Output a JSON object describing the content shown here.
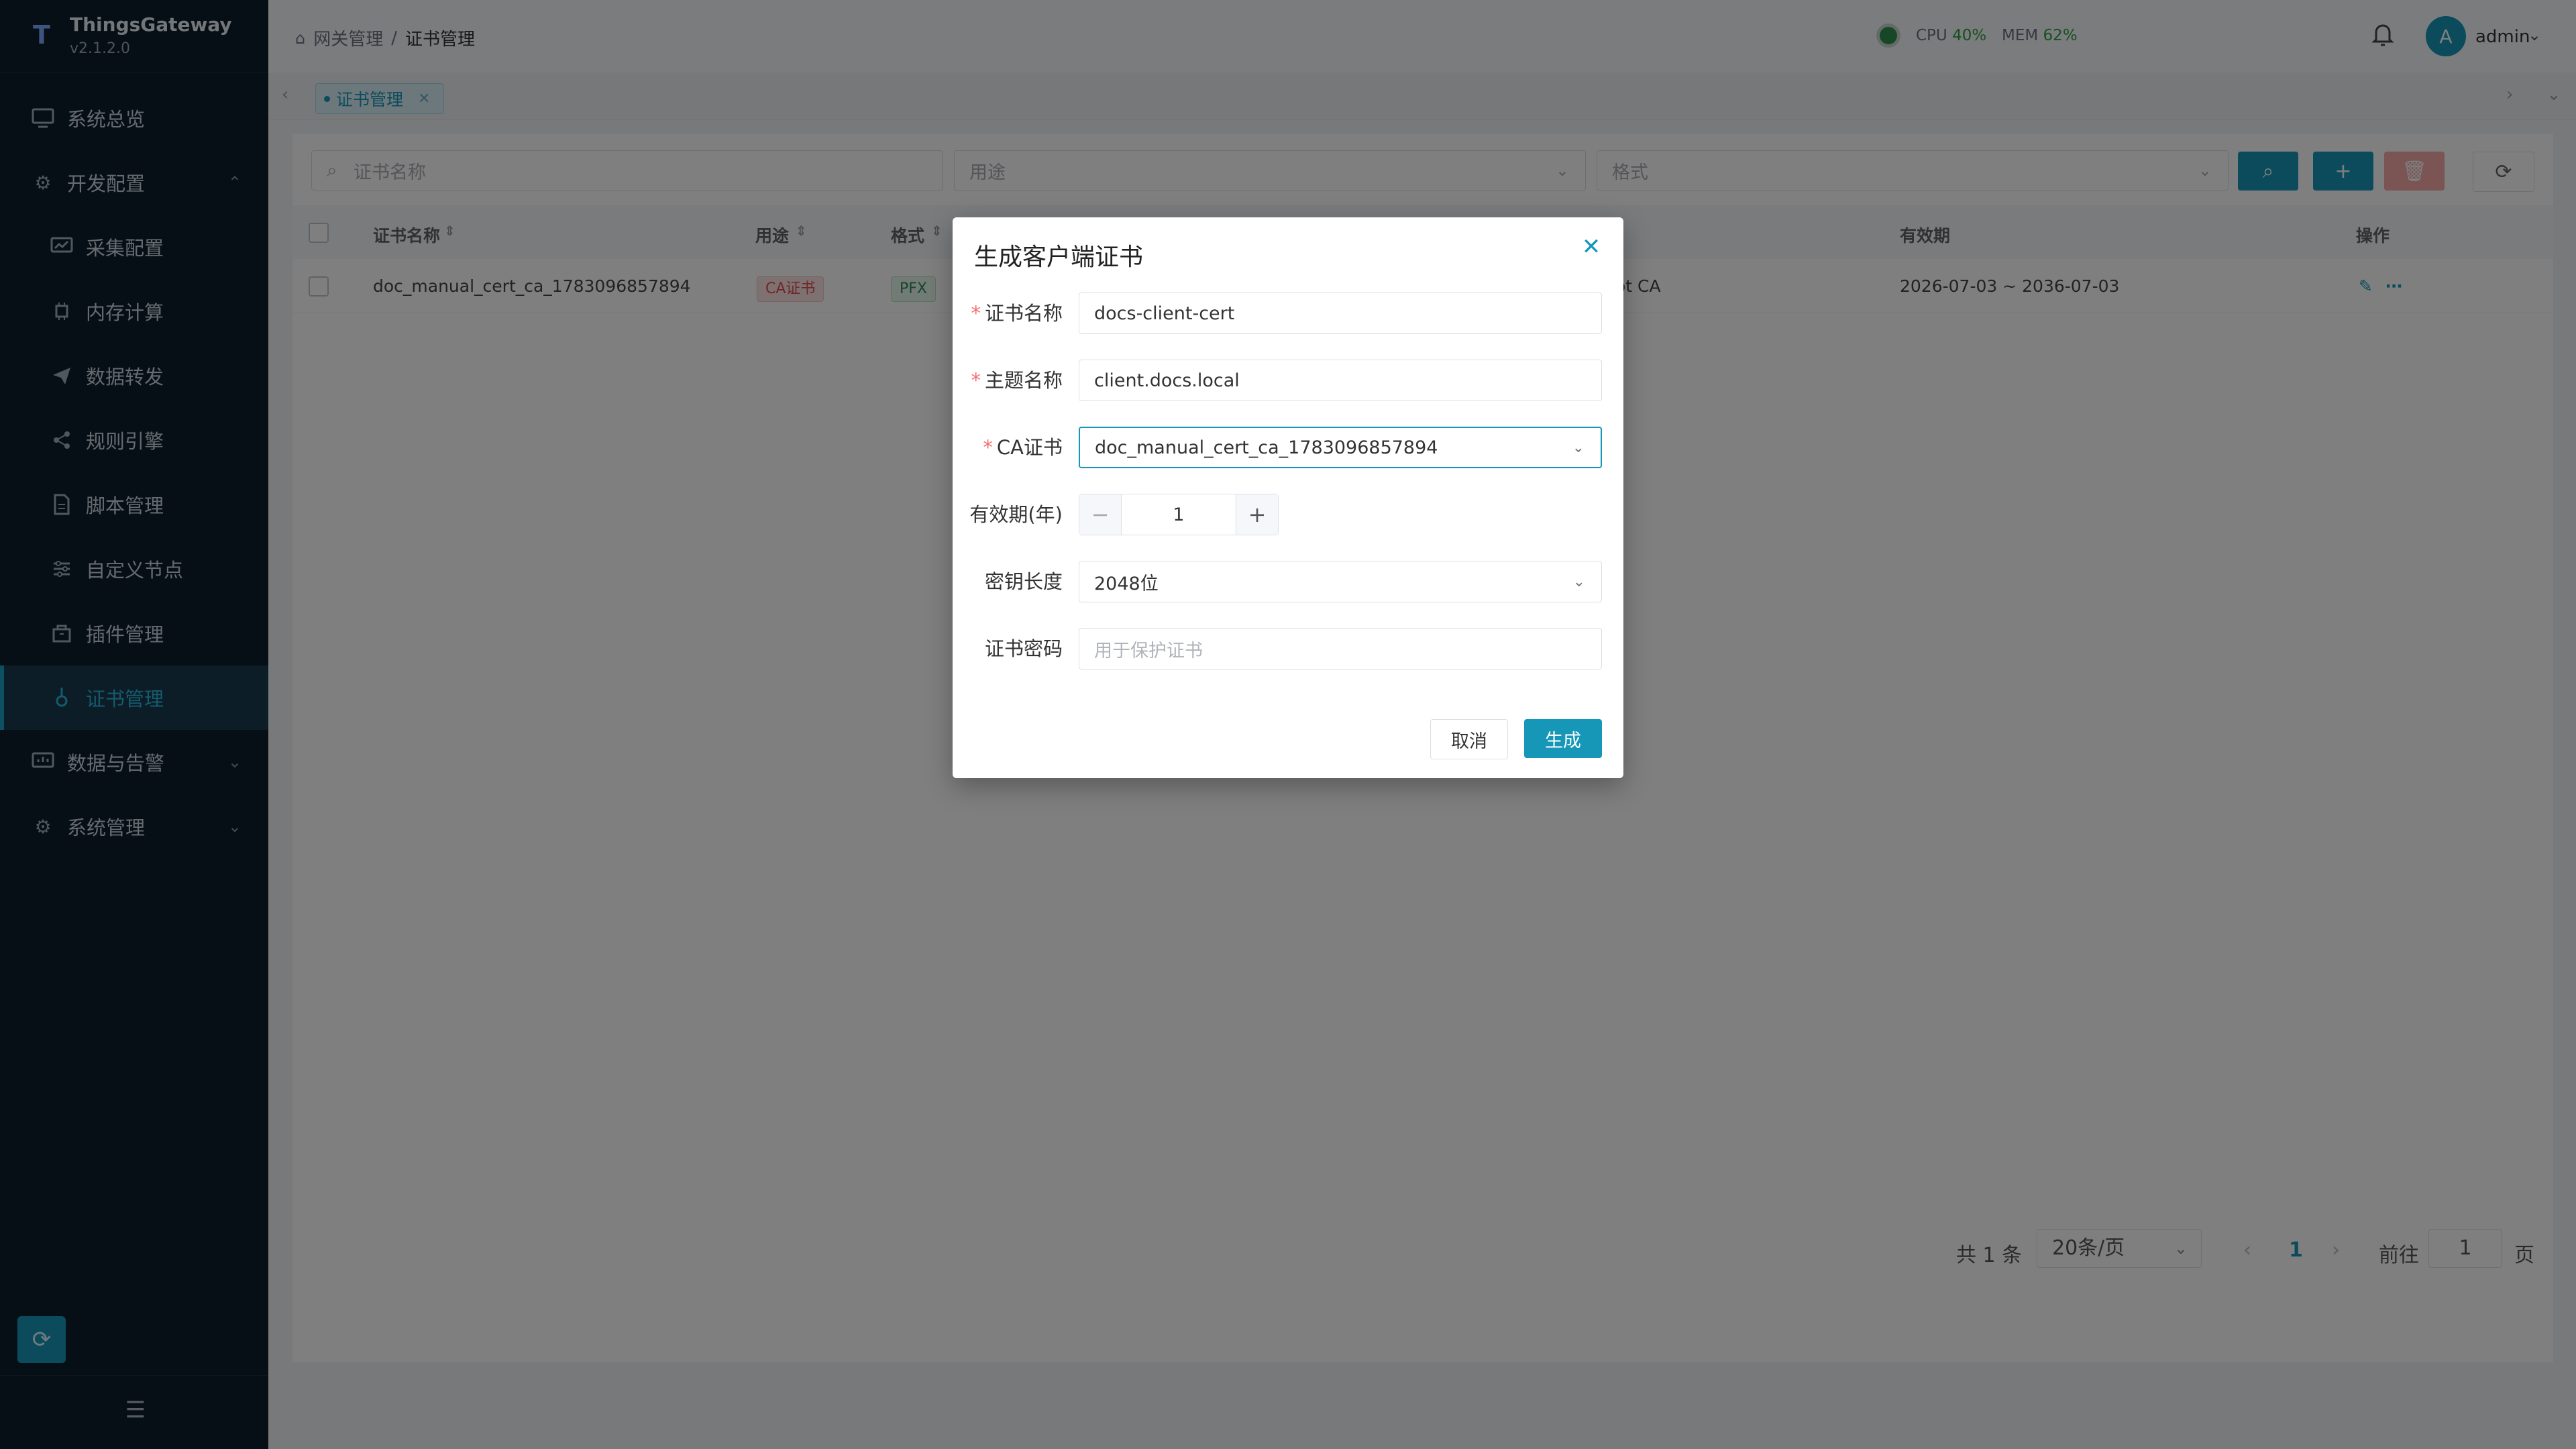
{
  "app": {
    "name": "ThingsGateway",
    "version": "v2.1.2.0",
    "logo_letter": "T"
  },
  "sidebar": {
    "items": [
      {
        "label": "系统总览",
        "icon": "monitor-icon"
      },
      {
        "label": "开发配置",
        "icon": "gear-icon"
      },
      {
        "label": "采集配置",
        "icon": "chart-icon"
      },
      {
        "label": "内存计算",
        "icon": "chip-icon"
      },
      {
        "label": "数据转发",
        "icon": "send-icon"
      },
      {
        "label": "规则引擎",
        "icon": "share-icon"
      },
      {
        "label": "脚本管理",
        "icon": "file-icon"
      },
      {
        "label": "自定义节点",
        "icon": "sliders-icon"
      },
      {
        "label": "插件管理",
        "icon": "plugin-icon"
      },
      {
        "label": "证书管理",
        "icon": "certificate-icon"
      },
      {
        "label": "数据与告警",
        "icon": "dashboard-icon"
      },
      {
        "label": "系统管理",
        "icon": "settings-icon"
      }
    ]
  },
  "header": {
    "breadcrumb": [
      "网关管理",
      "证书管理"
    ],
    "separator": "/",
    "cpu_label": "CPU",
    "cpu_value": "40%",
    "mem_label": "MEM",
    "mem_value": "62%",
    "user_initial": "A",
    "user_name": "admin"
  },
  "tabs": [
    {
      "label": "证书管理"
    }
  ],
  "filters": {
    "name_placeholder": "证书名称",
    "usage_placeholder": "用途",
    "format_placeholder": "格式"
  },
  "table": {
    "columns": {
      "name": "证书名称",
      "usage": "用途",
      "format": "格式",
      "validity": "有效期",
      "actions": "操作"
    },
    "rows": [
      {
        "name": "doc_manual_cert_ca_1783096857894",
        "usage": "CA证书",
        "format": "PFX",
        "subject_partial": "ot CA",
        "validity": "2026-07-03 ~ 2036-07-03"
      }
    ]
  },
  "pagination": {
    "total": "共 1 条",
    "page_size": "20条/页",
    "current_page": "1",
    "goto_label": "前往",
    "goto_value": "1",
    "page_suffix": "页"
  },
  "modal": {
    "title": "生成客户端证书",
    "fields": {
      "cert_name": {
        "label": "证书名称",
        "value": "docs-client-cert"
      },
      "subject": {
        "label": "主题名称",
        "value": "client.docs.local"
      },
      "ca": {
        "label": "CA证书",
        "value": "doc_manual_cert_ca_1783096857894"
      },
      "validity": {
        "label": "有效期(年)",
        "value": "1"
      },
      "key_length": {
        "label": "密钥长度",
        "value": "2048位"
      },
      "password": {
        "label": "证书密码",
        "placeholder": "用于保护证书"
      }
    },
    "cancel_label": "取消",
    "generate_label": "生成",
    "required_mark": "*"
  },
  "colors": {
    "primary": "#1697b8",
    "sidebar_bg": "#0f1e2d",
    "danger": "#f56c6c",
    "success": "#2ea043"
  }
}
